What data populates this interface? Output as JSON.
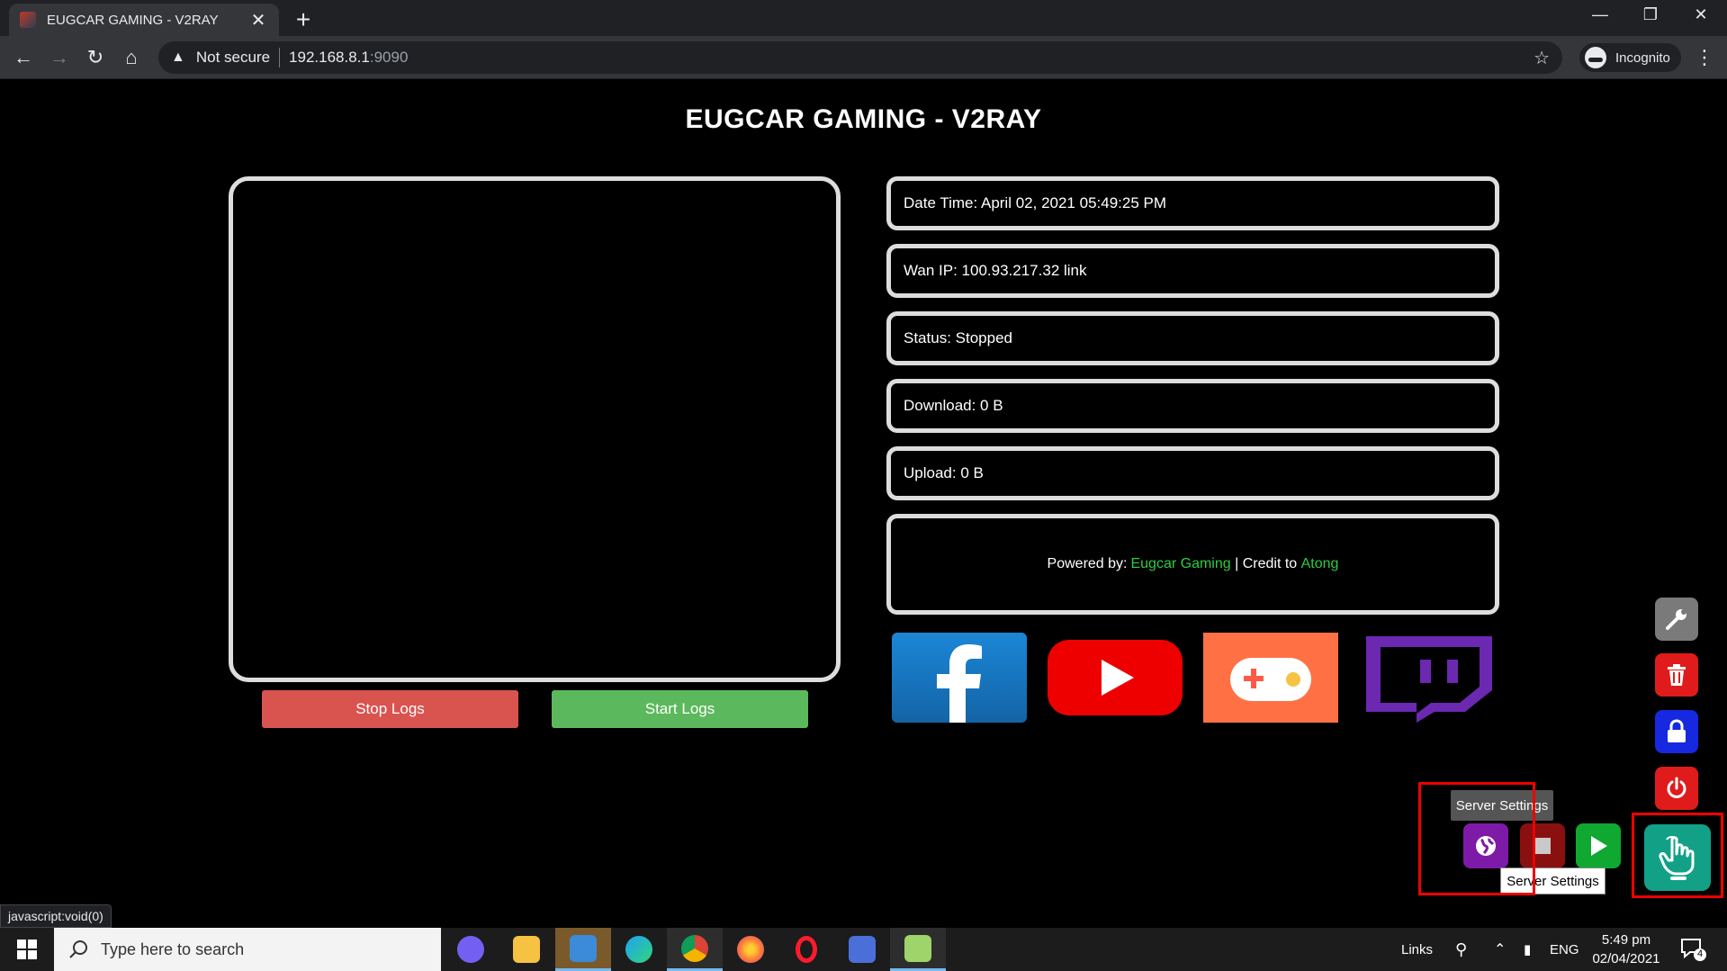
{
  "browser": {
    "tab_title": "EUGCAR GAMING - V2RAY",
    "tab_close": "✕",
    "new_tab": "+",
    "security_label": "Not secure",
    "url_host": "192.168.8.1",
    "url_port": ":9090",
    "profile_label": "Incognito",
    "status_url": "javascript:void(0)"
  },
  "page": {
    "title": "EUGCAR GAMING - V2RAY",
    "stop_logs_label": "Stop Logs",
    "start_logs_label": "Start Logs",
    "info": {
      "datetime": "Date Time: April 02, 2021 05:49:25 PM",
      "wan_ip": "Wan IP: 100.93.217.32 link",
      "status": "Status: Stopped",
      "download": "Download: 0 B",
      "upload": "Upload: 0 B"
    },
    "credits": {
      "powered_by_label": "Powered by: ",
      "powered_by_link": "Eugcar Gaming",
      "separator": " | Credit to ",
      "credit_link": "Atong"
    },
    "social": [
      "facebook-icon",
      "youtube-icon",
      "gamepad-icon",
      "twitch-icon"
    ],
    "fab": {
      "tooltip_top": "Server Settings",
      "tooltip_bottom": "Server Settings",
      "icons": [
        "wrench-icon",
        "trash-icon",
        "lock-icon",
        "power-icon",
        "globe-icon",
        "stop-icon",
        "play-icon",
        "hand-pointer-icon"
      ]
    }
  },
  "taskbar": {
    "search_placeholder": "Type here to search",
    "links_label": "Links",
    "lang": "ENG",
    "time": "5:49 pm",
    "date": "02/04/2021",
    "notification_count": "4"
  },
  "colors": {
    "stop_button": "#d9534f",
    "start_button": "#5cb85c",
    "credit_link": "#2ecc40",
    "fab_main": "#12a186"
  }
}
